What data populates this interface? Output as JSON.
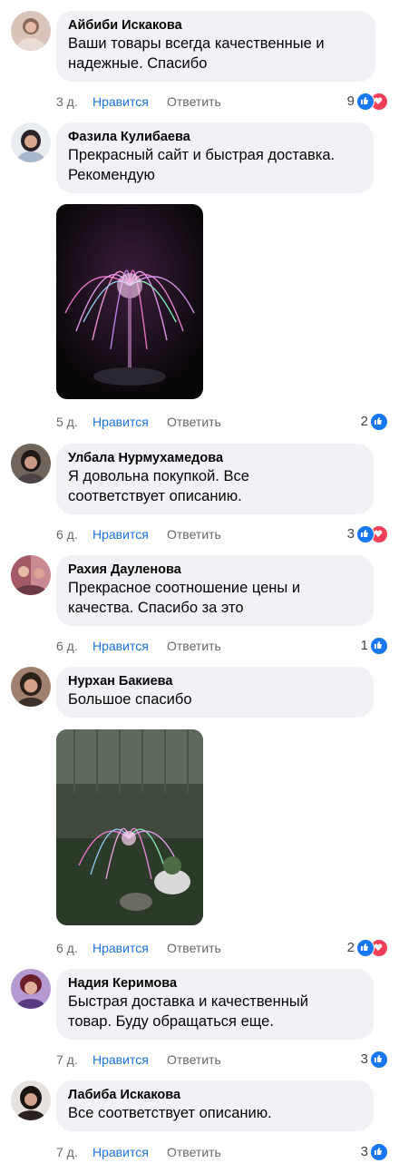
{
  "comments": [
    {
      "author": "Айбиби Искакова",
      "text": "Ваши товары всегда качественные и\nнадежные. Спасибо",
      "time": "3 д.",
      "like_label": "Нравится",
      "reply_label": "Ответить",
      "reaction_count": "9",
      "reactions": [
        "like",
        "love"
      ],
      "avatar_color": "#c9b1a6"
    },
    {
      "author": "Фазила Кулибаева",
      "text": "Прекрасный сайт и быстрая доставка.\nРекомендую",
      "time": "5 д.",
      "like_label": "Нравится",
      "reply_label": "Ответить",
      "reaction_count": "2",
      "reactions": [
        "like"
      ],
      "avatar_color": "#9fb3c8"
    },
    {
      "author": "Улбала Нурмухамедова",
      "text": "Я довольна покупкой. Все\nсоответствует описанию.",
      "time": "6 д.",
      "like_label": "Нравится",
      "reply_label": "Ответить",
      "reaction_count": "3",
      "reactions": [
        "like",
        "love"
      ],
      "avatar_color": "#7d6f63"
    },
    {
      "author": "Рахия Дауленова",
      "text": "Прекрасное соотношение цены и\nкачества. Спасибо за это",
      "time": "6 д.",
      "like_label": "Нравится",
      "reply_label": "Ответить",
      "reaction_count": "1",
      "reactions": [
        "like"
      ],
      "avatar_color": "#b0656e"
    },
    {
      "author": "Нурхан Бакиева",
      "text": "Большое спасибо",
      "time": "6 д.",
      "like_label": "Нравится",
      "reply_label": "Ответить",
      "reaction_count": "2",
      "reactions": [
        "like",
        "love"
      ],
      "avatar_color": "#8c6a5a"
    },
    {
      "author": "Надия Керимова",
      "text": "Быстрая доставка и качественный\nтовар. Буду обращаться еще.",
      "time": "7 д.",
      "like_label": "Нравится",
      "reply_label": "Ответить",
      "reaction_count": "3",
      "reactions": [
        "like"
      ],
      "avatar_color": "#7a4a8c"
    },
    {
      "author": "Лабиба Искакова",
      "text": "Все соответствует описанию.",
      "time": "7 д.",
      "like_label": "Нравится",
      "reply_label": "Ответить",
      "reaction_count": "3",
      "reactions": [
        "like"
      ],
      "avatar_color": "#5a4a44"
    }
  ],
  "colors": {
    "link_blue": "#1b74e4",
    "bubble_bg": "#f0f2f5",
    "meta_gray": "#65676b",
    "like_blue": "#1877f2",
    "love_red": "#f33e58"
  }
}
